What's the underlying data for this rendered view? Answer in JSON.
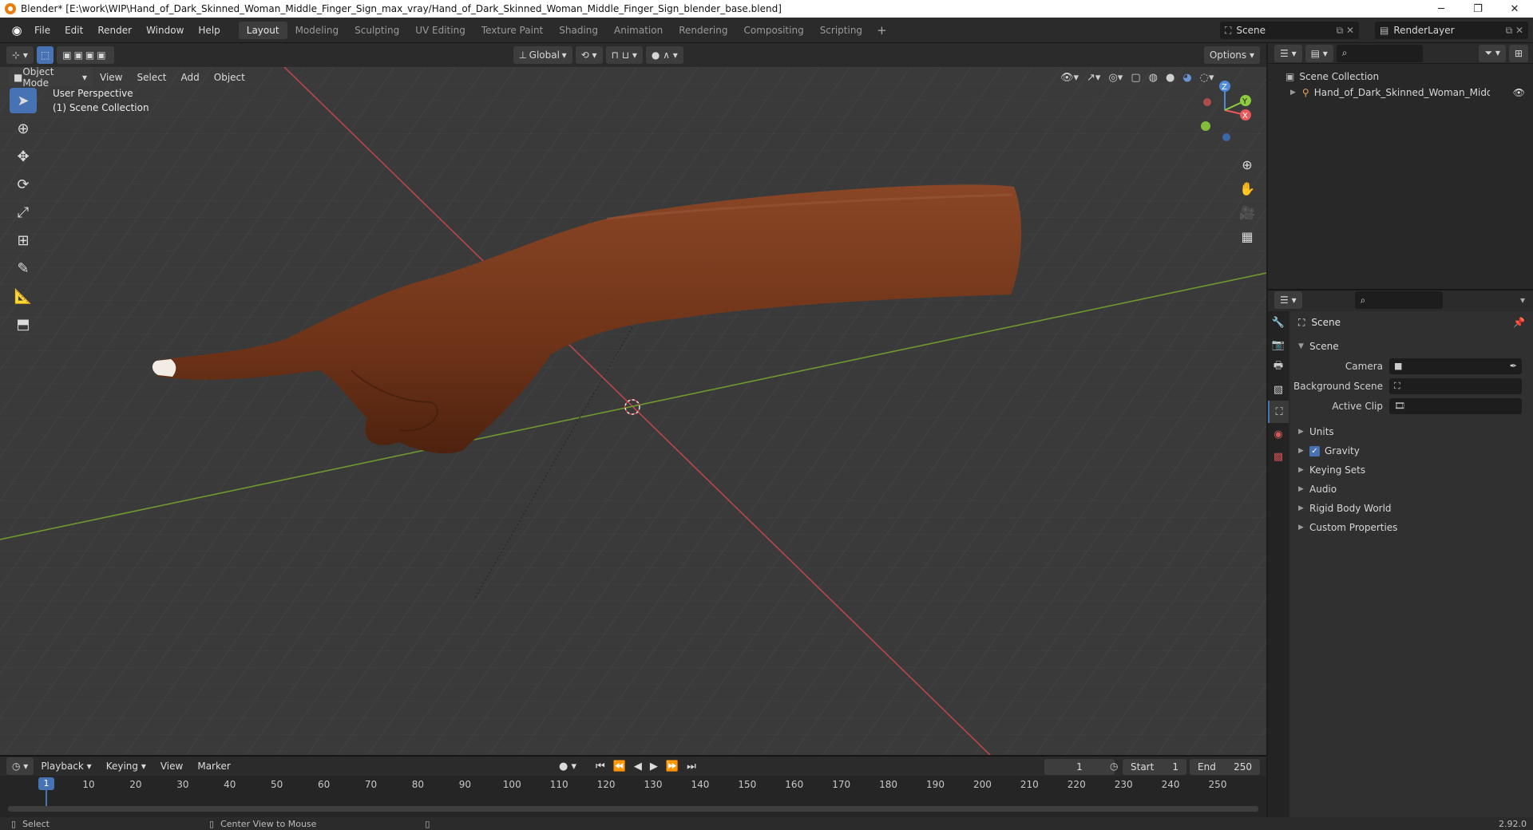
{
  "window": {
    "title": "Blender* [E:\\work\\WIP\\Hand_of_Dark_Skinned_Woman_Middle_Finger_Sign_max_vray/Hand_of_Dark_Skinned_Woman_Middle_Finger_Sign_blender_base.blend]",
    "min": "─",
    "max": "❐",
    "close": "✕"
  },
  "menu": [
    "File",
    "Edit",
    "Render",
    "Window",
    "Help"
  ],
  "workspaces": [
    "Layout",
    "Modeling",
    "Sculpting",
    "UV Editing",
    "Texture Paint",
    "Shading",
    "Animation",
    "Rendering",
    "Compositing",
    "Scripting"
  ],
  "scene_name": "Scene",
  "render_layer": "RenderLayer",
  "viewport": {
    "transform": "Global",
    "options": "Options",
    "mode": "Object Mode",
    "menu": [
      "View",
      "Select",
      "Add",
      "Object"
    ],
    "info_line1": "User Perspective",
    "info_line2": "(1) Scene Collection",
    "gizmo": {
      "z": "Z",
      "y": "Y",
      "x": "X"
    }
  },
  "outliner": {
    "collection": "Scene Collection",
    "object": "Hand_of_Dark_Skinned_Woman_Middle_Fing"
  },
  "properties": {
    "title": "Scene",
    "panel": "Scene",
    "rows": [
      {
        "label": "Camera"
      },
      {
        "label": "Background Scene"
      },
      {
        "label": "Active Clip"
      }
    ],
    "subpanels": [
      "Units",
      "Gravity",
      "Keying Sets",
      "Audio",
      "Rigid Body World",
      "Custom Properties"
    ]
  },
  "timeline": {
    "menu": [
      "Playback",
      "Keying",
      "View",
      "Marker"
    ],
    "current": "1",
    "start_label": "Start",
    "start": "1",
    "end_label": "End",
    "end": "250",
    "frames": [
      "1",
      "10",
      "20",
      "30",
      "40",
      "50",
      "60",
      "70",
      "80",
      "90",
      "100",
      "110",
      "120",
      "130",
      "140",
      "150",
      "160",
      "170",
      "180",
      "190",
      "200",
      "210",
      "220",
      "230",
      "240",
      "250"
    ]
  },
  "status": {
    "select": "Select",
    "center": "Center View to Mouse",
    "version": "2.92.0"
  },
  "colors": {
    "accent": "#4772b3",
    "x_axis": "#e85a5a",
    "y_axis": "#8ccc3d",
    "z_axis": "#4f8ad8",
    "skin": "#7a3b1f"
  }
}
